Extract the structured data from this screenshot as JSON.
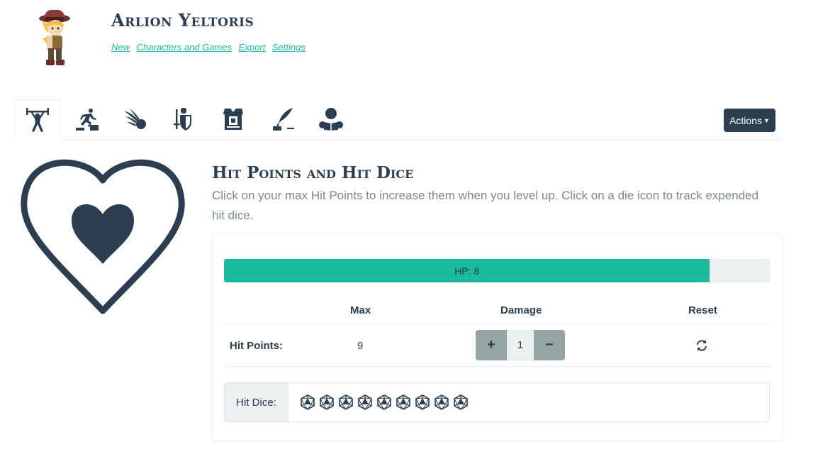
{
  "character": {
    "name": "Arlion Yeltoris",
    "avatar_icon": "adventurer-avatar"
  },
  "nav": {
    "links": [
      "New",
      "Characters and Games",
      "Export",
      "Settings"
    ]
  },
  "tabs": [
    {
      "icon": "weightlifter-icon",
      "active": true
    },
    {
      "icon": "running-stairs-icon",
      "active": false
    },
    {
      "icon": "fireball-icon",
      "active": false
    },
    {
      "icon": "knight-shield-icon",
      "active": false
    },
    {
      "icon": "armor-vest-icon",
      "active": false
    },
    {
      "icon": "quill-ink-icon",
      "active": false
    },
    {
      "icon": "reading-person-icon",
      "active": false
    }
  ],
  "actions": {
    "label": "Actions"
  },
  "section": {
    "icon": "heart-outline-icon",
    "title": "Hit Points and Hit Dice",
    "description": "Click on your max Hit Points to increase them when you level up. Click on a die icon to track expended hit dice."
  },
  "hp": {
    "bar_label": "HP: 8",
    "current": 8,
    "max": 9,
    "fill_percent": 88.9,
    "columns": {
      "max": "Max",
      "damage": "Damage",
      "reset": "Reset"
    },
    "row_label": "Hit Points:",
    "max_value": "9",
    "damage_value": "1",
    "plus": "+",
    "minus": "−"
  },
  "hit_dice": {
    "label": "Hit Dice:",
    "count": 9,
    "icon": "d20-die-icon"
  },
  "colors": {
    "primary": "#2c3e50",
    "accent": "#18bc9c",
    "bar_fill": "#1abc9c",
    "muted": "#95a5a6",
    "light": "#ecf0f1"
  }
}
